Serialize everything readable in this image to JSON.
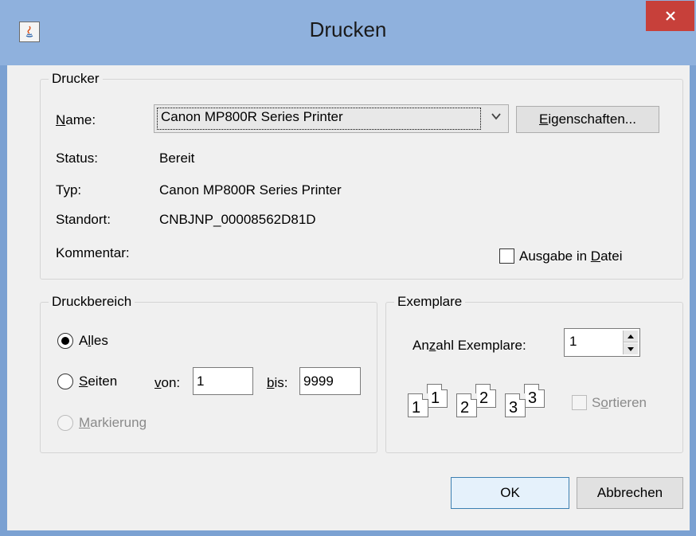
{
  "window": {
    "title": "Drucken",
    "app_icon": "java-icon",
    "close_icon": "close-icon",
    "colors": {
      "titlebar": "#8fb1dd",
      "close": "#c7403a",
      "client": "#f0f0f0"
    }
  },
  "printer": {
    "group_title": "Drucker",
    "name_label_pre": "",
    "name_label_u": "N",
    "name_label_post": "ame:",
    "name_value": "Canon MP800R Series Printer",
    "properties_u": "E",
    "properties_post": "igenschaften...",
    "status_label": "Status:",
    "status_value": "Bereit",
    "type_label": "Typ:",
    "type_value": "Canon MP800R Series Printer",
    "location_label": "Standort:",
    "location_value": "CNBJNP_00008562D81D",
    "comment_label": "Kommentar:",
    "print_to_file_pre": "Ausgabe in ",
    "print_to_file_u": "D",
    "print_to_file_post": "atei"
  },
  "range": {
    "group_title": "Druckbereich",
    "all_pre": "A",
    "all_u": "l",
    "all_post": "les",
    "pages_u": "S",
    "pages_post": "eiten",
    "from_u": "v",
    "from_post": "on:",
    "from_value": "1",
    "to_u": "b",
    "to_post": "is:",
    "to_value": "9999",
    "selection_u": "M",
    "selection_post": "arkierung"
  },
  "copies": {
    "group_title": "Exemplare",
    "count_pre": "An",
    "count_u": "z",
    "count_post": "ahl Exemplare:",
    "count_value": "1",
    "collate_pre": "S",
    "collate_u": "o",
    "collate_post": "rtieren",
    "collate_icon": "collate-pages-icon",
    "page_numbers": [
      "1",
      "1",
      "2",
      "2",
      "3",
      "3"
    ]
  },
  "buttons": {
    "ok": "OK",
    "cancel": "Abbrechen"
  }
}
